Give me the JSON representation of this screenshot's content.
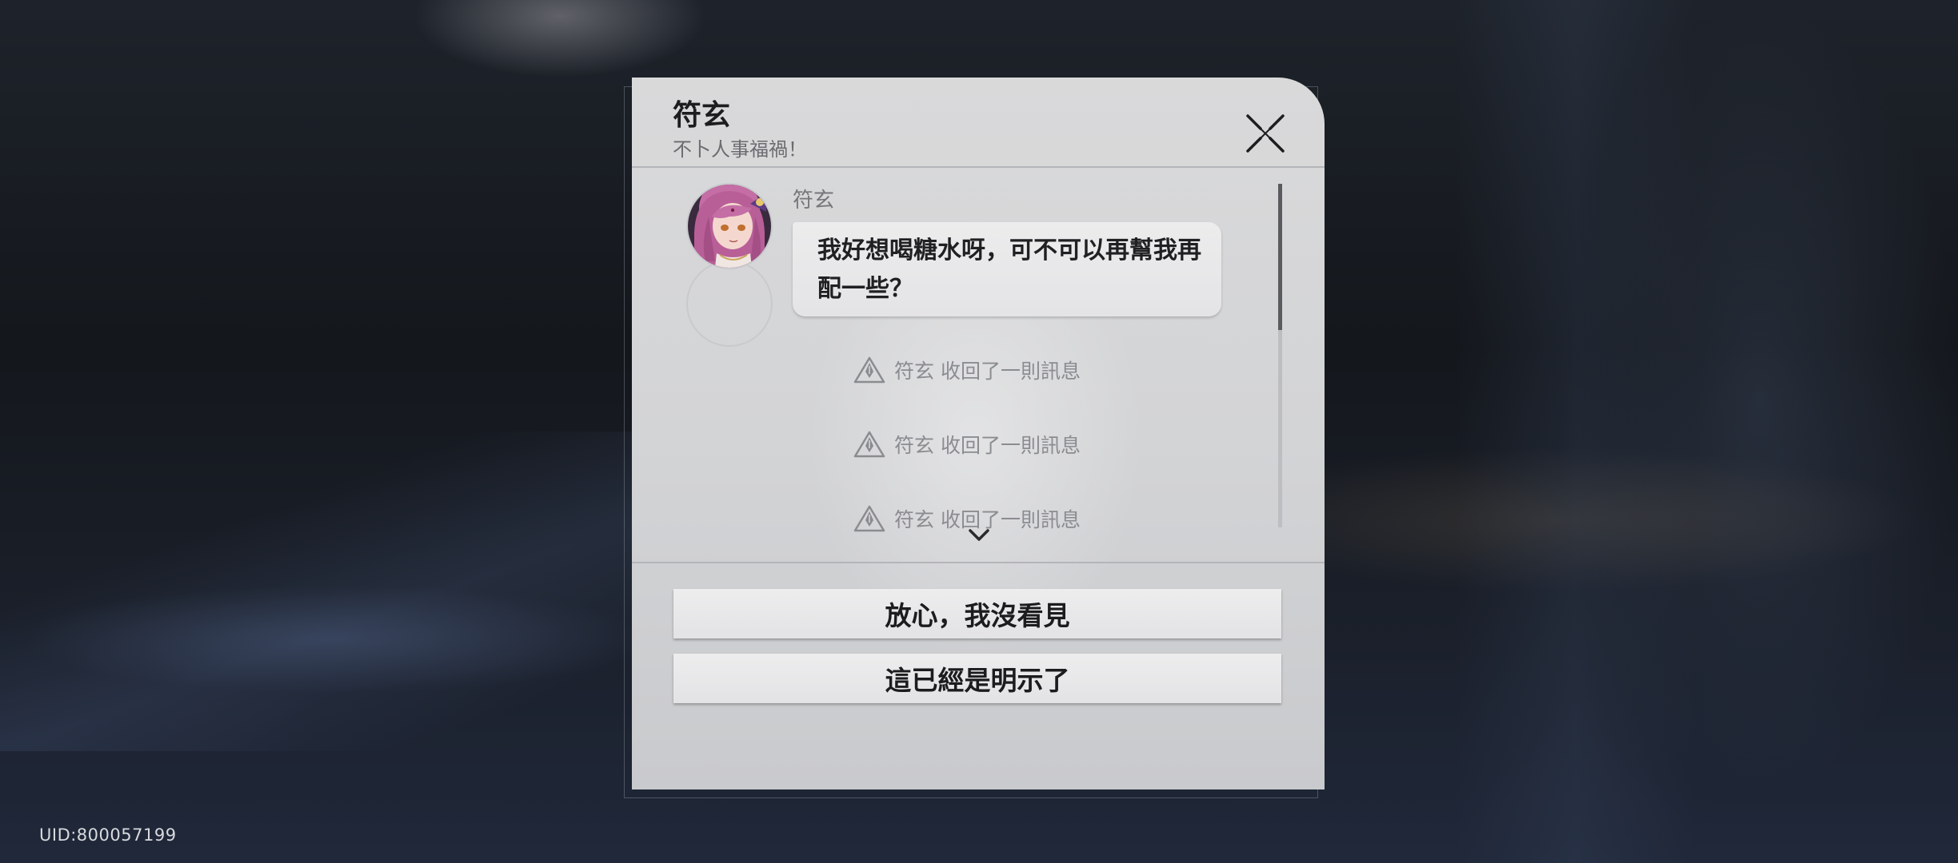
{
  "header": {
    "contact_name": "符玄",
    "contact_signature": "不卜人事福禍！"
  },
  "chat": {
    "sender_name": "符玄",
    "message": "我好想喝糖水呀，可不可以再幫我再配一些？",
    "system_notes": [
      "符玄 收回了一則訊息",
      "符玄 收回了一則訊息",
      "符玄 收回了一則訊息"
    ]
  },
  "replies": [
    "放心，我沒看見",
    "這已經是明示了"
  ],
  "footer": {
    "uid": "UID:800057199"
  },
  "colors": {
    "panel": "#d6d7d9",
    "bubble": "#e8e8ea",
    "text_dark": "#1d1d1f",
    "text_muted": "#8b8c90",
    "avatar_hair": "#c4679e"
  },
  "icons": {
    "close": "close-icon",
    "system_note": "warning-triangle-icon",
    "scroll_down": "chevron-down-icon"
  }
}
